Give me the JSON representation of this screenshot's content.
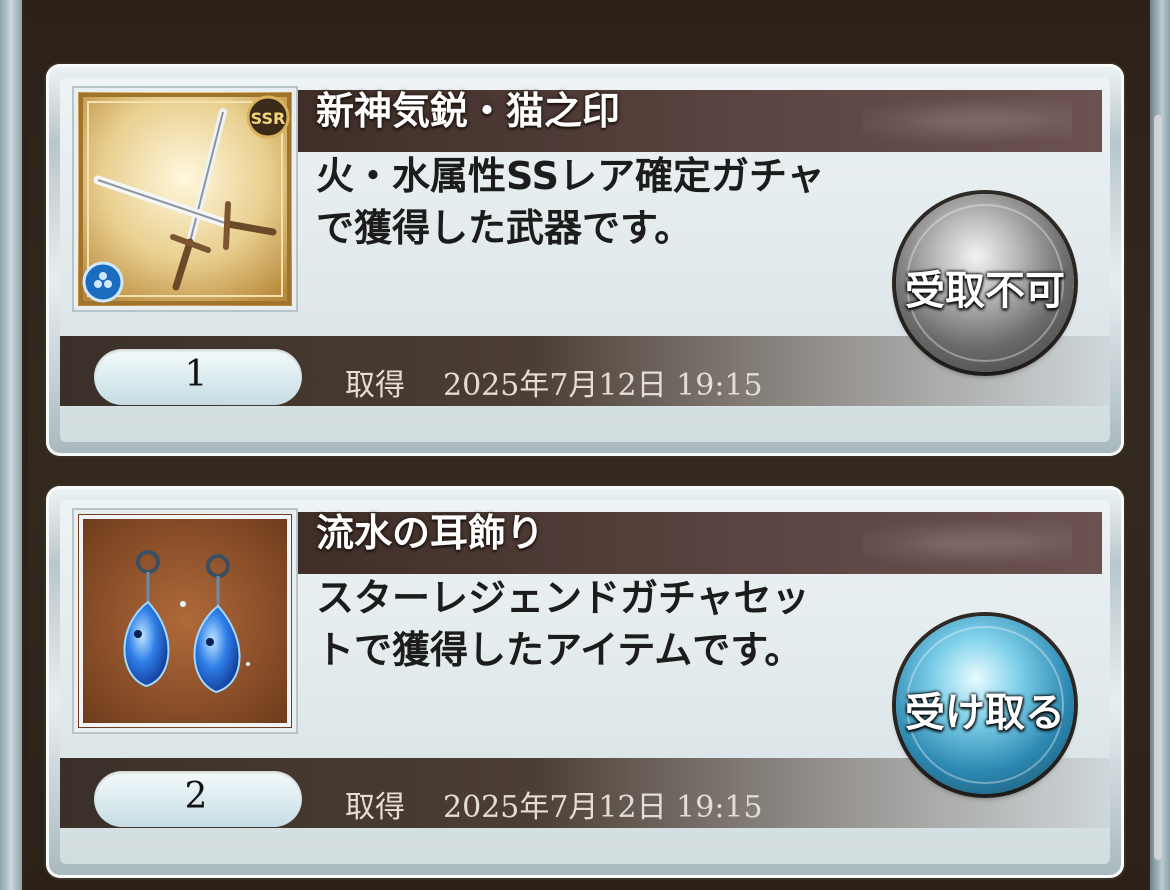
{
  "items": [
    {
      "name": "新神気鋭・猫之印",
      "description": "火・水属性SSレア確定ガチャで獲得した武器です。",
      "quantity": "1",
      "acquired_label": "取得",
      "acquired_date": "2025年7月12日 19:15",
      "button_label": "受取不可",
      "button_enabled": false,
      "icon": "twin-daggers-weapon-icon",
      "rarity_badge": "SSR",
      "element_badge": "water-element-icon"
    },
    {
      "name": "流水の耳飾り",
      "description": "スターレジェンドガチャセットで獲得したアイテムです。",
      "quantity": "2",
      "acquired_label": "取得",
      "acquired_date": "2025年7月12日 19:15",
      "button_label": "受け取る",
      "button_enabled": true,
      "icon": "blue-earrings-icon"
    }
  ],
  "colors": {
    "title_band": "#3e2e27",
    "disabled_button": "#6b6b6b",
    "active_button": "#2c88b1"
  }
}
